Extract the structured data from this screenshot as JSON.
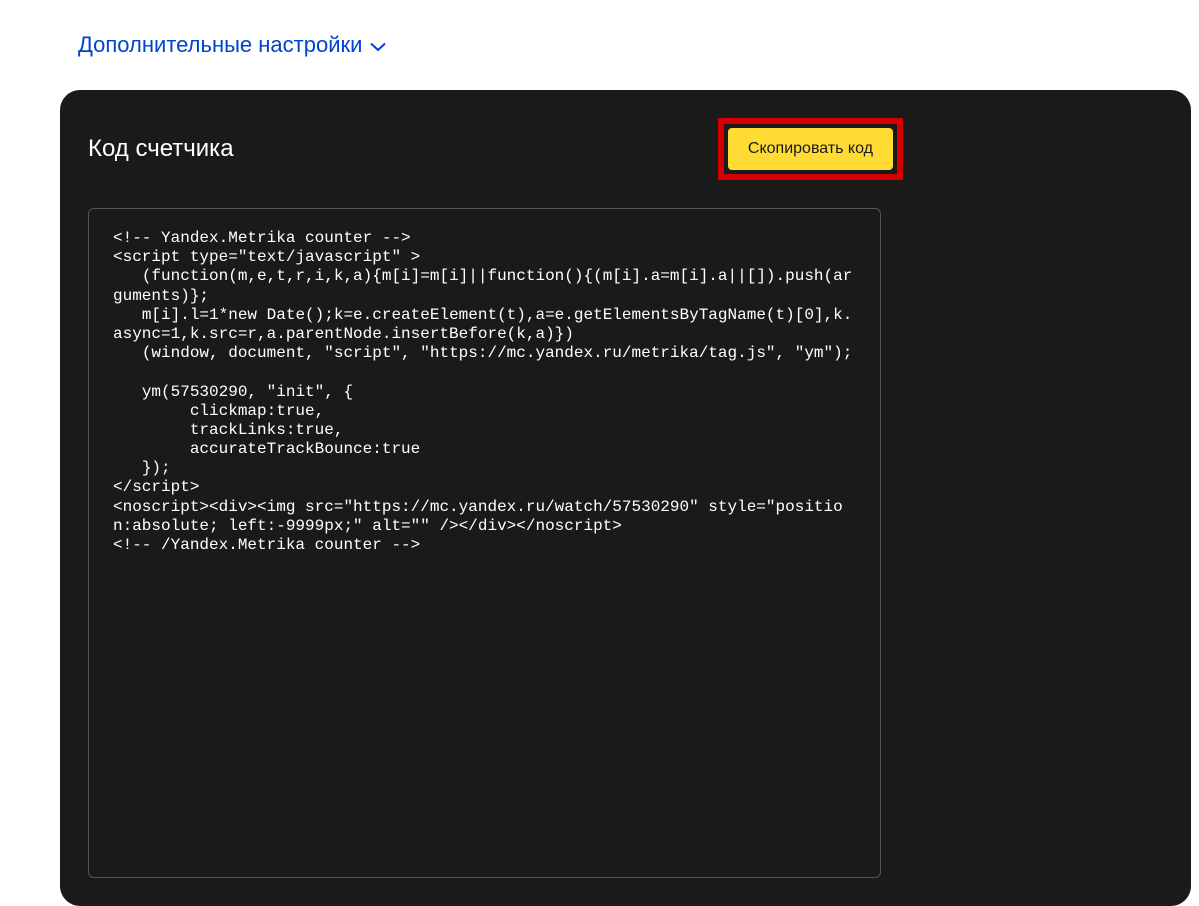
{
  "settings_toggle": {
    "label": "Дополнительные настройки"
  },
  "code_panel": {
    "title": "Код счетчика",
    "copy_button_label": "Скопировать код",
    "code": "<!-- Yandex.Metrika counter -->\n<script type=\"text/javascript\" >\n   (function(m,e,t,r,i,k,a){m[i]=m[i]||function(){(m[i].a=m[i].a||[]).push(arguments)};\n   m[i].l=1*new Date();k=e.createElement(t),a=e.getElementsByTagName(t)[0],k.async=1,k.src=r,a.parentNode.insertBefore(k,a)})\n   (window, document, \"script\", \"https://mc.yandex.ru/metrika/tag.js\", \"ym\");\n\n   ym(57530290, \"init\", {\n        clickmap:true,\n        trackLinks:true,\n        accurateTrackBounce:true\n   });\n</script>\n<noscript><div><img src=\"https://mc.yandex.ru/watch/57530290\" style=\"position:absolute; left:-9999px;\" alt=\"\" /></div></noscript>\n<!-- /Yandex.Metrika counter -->"
  }
}
